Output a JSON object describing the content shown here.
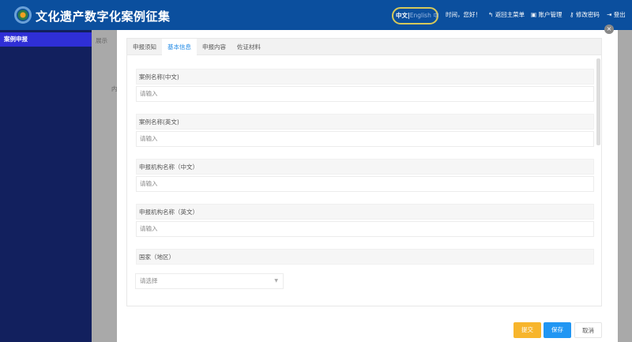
{
  "header": {
    "title": "文化遗产数字化案例征集",
    "lang_active": "中文",
    "lang_sep": "|",
    "lang_other": "English",
    "lang_icon": "中",
    "greeting": "时间，您好！",
    "nav": [
      {
        "label": "返回主菜单",
        "icon": "back-arrow-icon"
      },
      {
        "label": "账户管理",
        "icon": "id-card-icon"
      },
      {
        "label": "修改密码",
        "icon": "key-icon"
      },
      {
        "label": "登出",
        "icon": "logout-icon"
      }
    ]
  },
  "sidebar": {
    "items": [
      {
        "label": "案例申报"
      }
    ]
  },
  "background": {
    "text1": "展示",
    "text2": "内"
  },
  "modal": {
    "tabs": [
      {
        "label": "申报须知"
      },
      {
        "label": "基本信息",
        "active": true
      },
      {
        "label": "申报内容"
      },
      {
        "label": "佐证材料"
      }
    ],
    "fields": [
      {
        "label": "案例名称(中文)",
        "placeholder": "请输入"
      },
      {
        "label": "案例名称(英文)",
        "placeholder": "请输入"
      },
      {
        "label": "申报机构名称（中文）",
        "placeholder": "请输入"
      },
      {
        "label": "申报机构名称（英文）",
        "placeholder": "请输入"
      }
    ],
    "country": {
      "label": "国家（地区）",
      "placeholder": "请选择"
    },
    "buttons": {
      "submit": "提交",
      "save": "保存",
      "cancel": "取消"
    },
    "close": "×"
  },
  "colors": {
    "header": "#0b4f9e",
    "sidebar": "#12205e",
    "submit": "#f7b52c",
    "save": "#2196f3"
  }
}
